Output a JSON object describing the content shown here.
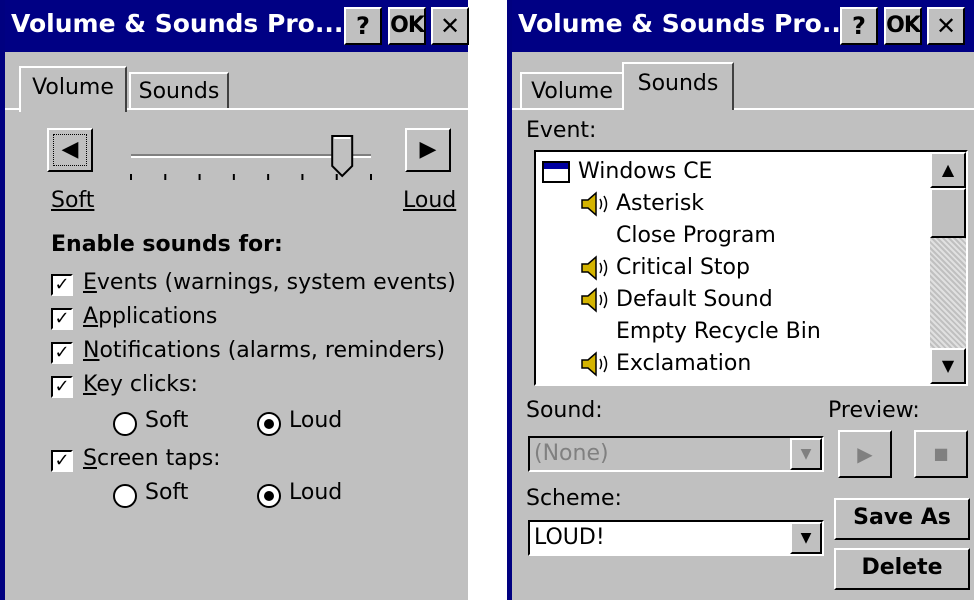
{
  "left_dialog": {
    "title": "Volume & Sounds Pro...",
    "title_buttons": {
      "help": "?",
      "ok": "OK",
      "close": "✕"
    },
    "tabs": [
      {
        "label": "Volume",
        "active": true
      },
      {
        "label": "Sounds",
        "active": false
      }
    ],
    "volume": {
      "soft_label": "Soft",
      "loud_label": "Loud",
      "level": 0.88
    },
    "enable_heading": "Enable sounds for:",
    "checkboxes": [
      {
        "label": "Events (warnings, system events)",
        "checked": true
      },
      {
        "label": "Applications",
        "checked": true
      },
      {
        "label": "Notifications (alarms, reminders)",
        "checked": true
      },
      {
        "label": "Key clicks:",
        "checked": true
      },
      {
        "label": "Screen taps:",
        "checked": true
      }
    ],
    "key_clicks_options": [
      {
        "label": "Soft",
        "selected": false
      },
      {
        "label": "Loud",
        "selected": true
      }
    ],
    "screen_taps_options": [
      {
        "label": "Soft",
        "selected": false
      },
      {
        "label": "Loud",
        "selected": true
      }
    ]
  },
  "right_dialog": {
    "title": "Volume & Sounds Pro...",
    "title_buttons": {
      "help": "?",
      "ok": "OK",
      "close": "✕"
    },
    "tabs": [
      {
        "label": "Volume",
        "active": false
      },
      {
        "label": "Sounds",
        "active": true
      }
    ],
    "event_label": "Event:",
    "events": [
      {
        "label": "Windows CE",
        "icon": "window-icon"
      },
      {
        "label": "Asterisk",
        "icon": "speaker-icon"
      },
      {
        "label": "Close Program",
        "icon": ""
      },
      {
        "label": "Critical Stop",
        "icon": "speaker-icon"
      },
      {
        "label": "Default Sound",
        "icon": "speaker-icon"
      },
      {
        "label": "Empty Recycle Bin",
        "icon": ""
      },
      {
        "label": "Exclamation",
        "icon": "speaker-icon"
      }
    ],
    "sound_label": "Sound:",
    "sound_value": "(None)",
    "preview_label": "Preview:",
    "scheme_label": "Scheme:",
    "scheme_value": "LOUD!",
    "save_as_label": "Save As",
    "delete_label": "Delete"
  },
  "colors": {
    "title_bar": "#000084",
    "dialog": "#c0c0c0",
    "speaker": "#d4b400"
  }
}
